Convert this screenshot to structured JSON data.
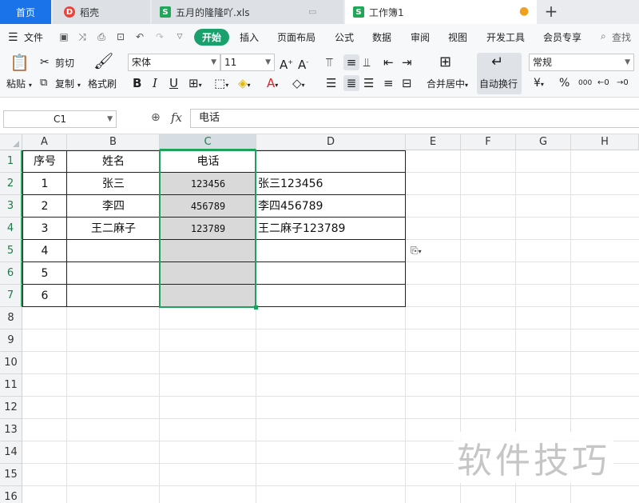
{
  "tabs": {
    "home": "首页",
    "daoke": "稻壳",
    "file": "五月的隆隆吖.xls",
    "book": "工作簿1",
    "new": "+"
  },
  "menu": {
    "file": "文件",
    "start": "开始",
    "insert": "插入",
    "layout": "页面布局",
    "formula": "公式",
    "data": "数据",
    "review": "审阅",
    "view": "视图",
    "dev": "开发工具",
    "vip": "会员专享",
    "search": "查找"
  },
  "toolbar": {
    "paste": "粘贴",
    "cut": "剪切",
    "copy": "复制",
    "format_painter": "格式刷",
    "font_name": "宋体",
    "font_size": "11",
    "bold": "B",
    "italic": "I",
    "underline": "U",
    "merge_center": "合并居中",
    "wrap_text": "自动换行",
    "number_format": "常规",
    "currency": "¥",
    "percent": "%",
    "thousands": "000"
  },
  "formula_bar": {
    "cell_ref": "C1",
    "fx": "fx",
    "content": "电话"
  },
  "sheet": {
    "columns": [
      "A",
      "B",
      "C",
      "D",
      "E",
      "F",
      "G",
      "H"
    ],
    "selected_column": "C",
    "rows": [
      "1",
      "2",
      "3",
      "4",
      "5",
      "6",
      "7",
      "8",
      "9",
      "10",
      "11",
      "12",
      "13",
      "14",
      "15",
      "16"
    ],
    "headers": [
      "序号",
      "姓名",
      "电话"
    ],
    "data": [
      {
        "seq": "1",
        "name": "张三",
        "phone": "123456",
        "combined": "张三123456"
      },
      {
        "seq": "2",
        "name": "李四",
        "phone": "456789",
        "combined": "李四456789"
      },
      {
        "seq": "3",
        "name": "王二麻子",
        "phone": "123789",
        "combined": "王二麻子123789"
      },
      {
        "seq": "4",
        "name": "",
        "phone": "",
        "combined": ""
      },
      {
        "seq": "5",
        "name": "",
        "phone": "",
        "combined": ""
      },
      {
        "seq": "6",
        "name": "",
        "phone": "",
        "combined": ""
      }
    ]
  },
  "watermark": "软件技巧"
}
